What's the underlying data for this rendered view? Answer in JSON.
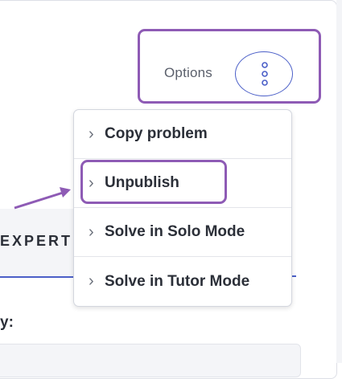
{
  "header": {
    "options_label": "Options"
  },
  "menu": {
    "items": [
      {
        "label": "Copy problem"
      },
      {
        "label": "Unpublish"
      },
      {
        "label": "Solve in Solo Mode"
      },
      {
        "label": "Solve in Tutor Mode"
      }
    ]
  },
  "tabs": {
    "active_label": "EXPERT"
  },
  "section": {
    "label": "y:"
  },
  "icons": {
    "kebab": "vertical-ellipsis-icon",
    "chevron": "chevron-right-icon",
    "annotation_arrow": "arrow-icon"
  },
  "colors": {
    "highlight": "#8e5bb5",
    "accent": "#4b5fc8",
    "text": "#2b2f38"
  }
}
